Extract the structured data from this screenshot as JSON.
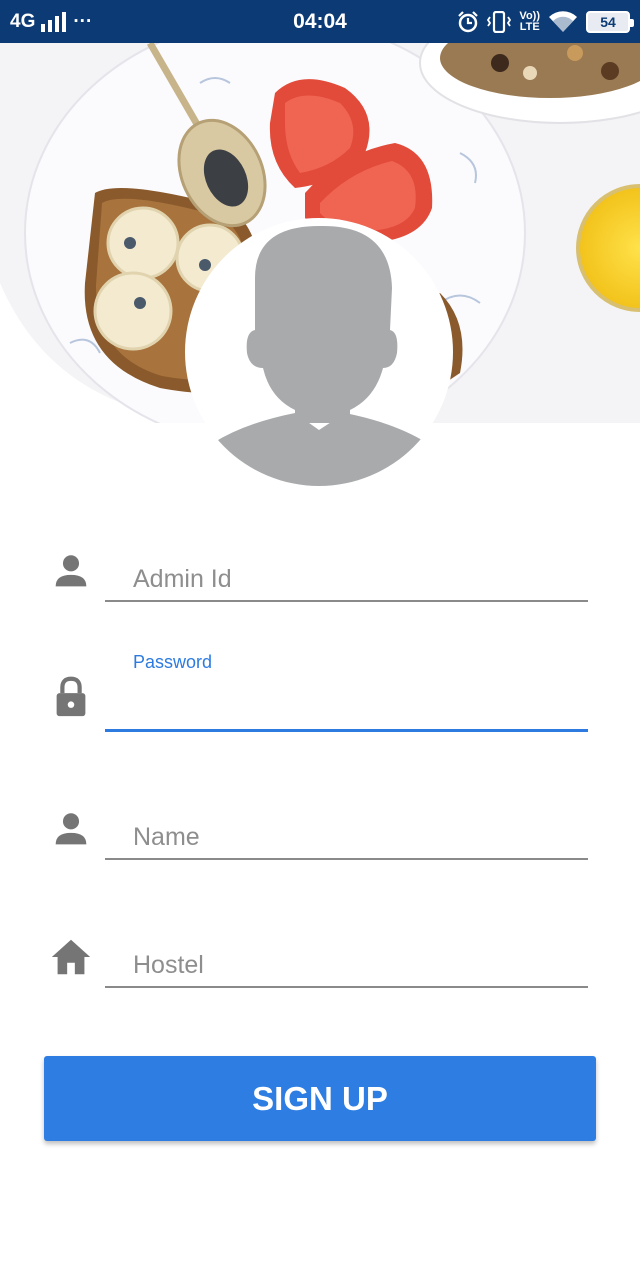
{
  "status_bar": {
    "network": "4G",
    "dots": "···",
    "time": "04:04",
    "volte_top": "Vo))",
    "volte_bottom": "LTE",
    "battery": "54"
  },
  "form": {
    "admin_id": {
      "placeholder": "Admin Id",
      "icon": "person-icon"
    },
    "password": {
      "label": "Password",
      "value": "",
      "icon": "lock-icon"
    },
    "name": {
      "placeholder": "Name",
      "icon": "person-icon"
    },
    "hostel": {
      "placeholder": "Hostel",
      "icon": "home-icon"
    }
  },
  "signup_button": {
    "label": "SIGN UP"
  },
  "colors": {
    "status_bar": "#0b3a75",
    "accent": "#2d7be0",
    "icon_gray": "#757575"
  }
}
